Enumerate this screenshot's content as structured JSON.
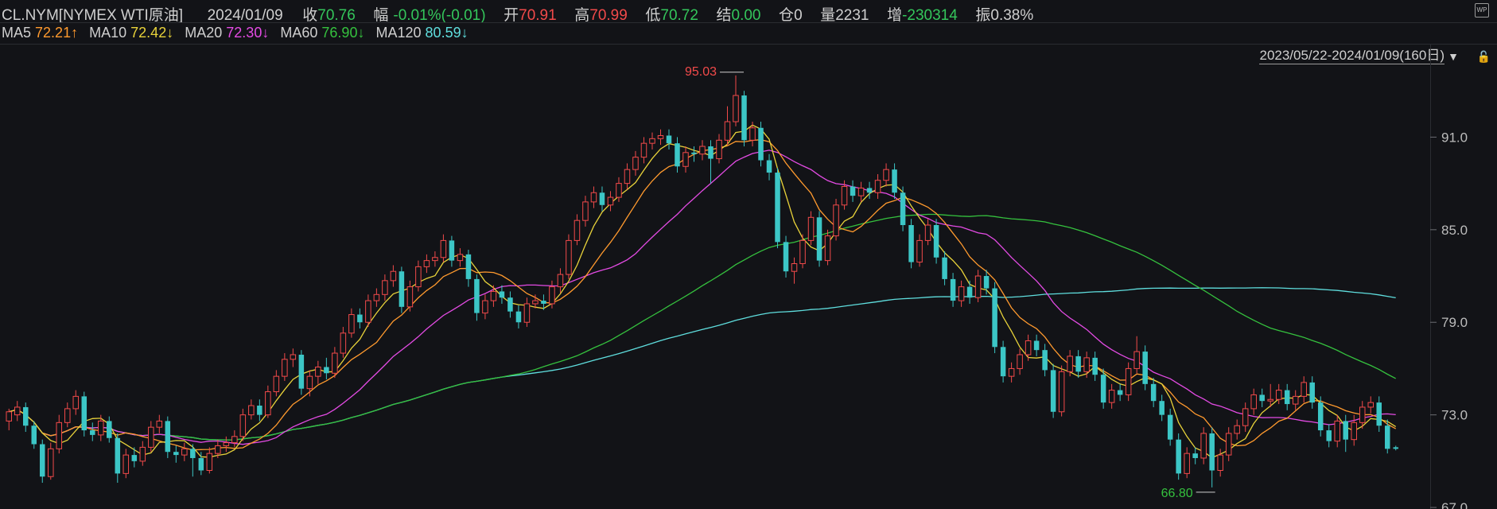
{
  "header": {
    "symbol": "CL.NYM[NYMEX WTI原油]",
    "date": "2024/01/09",
    "close_label": "收",
    "close_value": "70.76",
    "change_label": "幅",
    "change_value": "-0.01%(-0.01)",
    "open_label": "开",
    "open_value": "70.91",
    "high_label": "高",
    "high_value": "70.99",
    "low_label": "低",
    "low_value": "70.72",
    "settle_label": "结",
    "settle_value": "0.00",
    "oi_label": "仓",
    "oi_value": "0",
    "volume_label": "量",
    "volume_value": "2231",
    "increase_label": "增",
    "increase_value": "-230314",
    "amplitude_label": "振",
    "amplitude_value": "0.38%"
  },
  "ma_bar": {
    "ma5_label": "MA5",
    "ma5_value": "72.21↑",
    "ma10_label": "MA10",
    "ma10_value": "72.42↓",
    "ma20_label": "MA20",
    "ma20_value": "72.30↓",
    "ma60_label": "MA60",
    "ma60_value": "76.90↓",
    "ma120_label": "MA120",
    "ma120_value": "80.59↓"
  },
  "range_label": "2023/05/22-2024/01/09(160日)",
  "dropdown_icon": "triangle-down-icon",
  "wp_badge": "WP",
  "lock_icon": "lock-icon",
  "colors": {
    "up": "#f24a4a",
    "down": "#3cc6c6",
    "ma5": "#e8d23a",
    "ma10": "#ff9a2e",
    "ma20": "#e44be4",
    "ma60": "#35c13e",
    "ma120": "#5fdede",
    "bg": "#121317"
  },
  "chart_data": {
    "type": "candlestick",
    "y_ticks": [
      "91.0",
      "85.0",
      "79.0",
      "73.0",
      "67.0"
    ],
    "y_tick_values": [
      91,
      85,
      79,
      73,
      67
    ],
    "ylim": [
      66.9,
      97.0
    ],
    "max_annotation": "95.03",
    "min_annotation": "66.80",
    "candles": [
      [
        72.6,
        73.2,
        72.0,
        73.4
      ],
      [
        73.0,
        73.5,
        72.6,
        73.9
      ],
      [
        73.5,
        72.3,
        71.9,
        73.8
      ],
      [
        72.3,
        71.1,
        70.8,
        72.6
      ],
      [
        71.1,
        69.0,
        68.6,
        71.4
      ],
      [
        69.0,
        70.8,
        68.8,
        71.2
      ],
      [
        70.8,
        72.5,
        70.5,
        73.0
      ],
      [
        72.5,
        73.4,
        72.2,
        73.8
      ],
      [
        73.4,
        74.2,
        73.0,
        74.6
      ],
      [
        74.2,
        72.0,
        71.6,
        74.5
      ],
      [
        72.0,
        71.7,
        71.3,
        72.5
      ],
      [
        71.7,
        72.6,
        71.3,
        73.0
      ],
      [
        72.6,
        71.5,
        71.2,
        72.9
      ],
      [
        71.5,
        69.2,
        68.6,
        71.8
      ],
      [
        69.2,
        70.4,
        68.9,
        70.8
      ],
      [
        70.4,
        70.0,
        69.6,
        70.9
      ],
      [
        70.0,
        70.9,
        69.7,
        71.3
      ],
      [
        70.9,
        72.2,
        70.6,
        72.6
      ],
      [
        72.2,
        72.6,
        71.8,
        73.0
      ],
      [
        72.6,
        70.6,
        70.2,
        72.9
      ],
      [
        70.6,
        70.4,
        69.9,
        71.0
      ],
      [
        70.4,
        70.8,
        70.0,
        71.2
      ],
      [
        70.8,
        70.2,
        69.0,
        71.1
      ],
      [
        70.2,
        69.4,
        69.1,
        70.6
      ],
      [
        69.4,
        70.5,
        69.2,
        70.9
      ],
      [
        70.5,
        71.0,
        70.2,
        71.4
      ],
      [
        71.0,
        71.2,
        70.6,
        71.6
      ],
      [
        71.2,
        71.6,
        70.9,
        72.0
      ],
      [
        71.6,
        73.0,
        71.3,
        73.4
      ],
      [
        73.0,
        73.6,
        72.7,
        74.0
      ],
      [
        73.6,
        73.0,
        72.6,
        74.0
      ],
      [
        73.0,
        74.5,
        72.8,
        74.9
      ],
      [
        74.5,
        75.5,
        74.2,
        75.9
      ],
      [
        75.5,
        76.6,
        75.2,
        77.0
      ],
      [
        76.6,
        76.9,
        76.1,
        77.3
      ],
      [
        76.9,
        74.7,
        74.3,
        77.2
      ],
      [
        74.7,
        75.5,
        74.2,
        75.9
      ],
      [
        75.5,
        76.1,
        75.0,
        76.5
      ],
      [
        76.1,
        75.7,
        75.3,
        76.7
      ],
      [
        75.7,
        77.0,
        75.4,
        77.4
      ],
      [
        77.0,
        78.3,
        76.7,
        78.7
      ],
      [
        78.3,
        79.5,
        78.0,
        79.9
      ],
      [
        79.5,
        79.0,
        78.6,
        79.9
      ],
      [
        79.0,
        80.4,
        78.7,
        80.8
      ],
      [
        80.4,
        80.8,
        80.0,
        81.2
      ],
      [
        80.8,
        81.7,
        80.4,
        82.1
      ],
      [
        81.7,
        82.3,
        81.3,
        82.7
      ],
      [
        82.3,
        80.0,
        79.6,
        82.6
      ],
      [
        80.0,
        81.3,
        79.7,
        81.7
      ],
      [
        81.3,
        82.6,
        81.0,
        83.0
      ],
      [
        82.6,
        83.0,
        82.2,
        83.4
      ],
      [
        83.0,
        83.2,
        82.6,
        83.6
      ],
      [
        83.2,
        84.3,
        82.9,
        84.7
      ],
      [
        84.3,
        83.0,
        82.6,
        84.6
      ],
      [
        83.0,
        83.4,
        82.6,
        83.8
      ],
      [
        83.4,
        81.8,
        81.3,
        83.7
      ],
      [
        81.8,
        79.6,
        79.1,
        82.1
      ],
      [
        79.6,
        80.4,
        79.2,
        80.8
      ],
      [
        80.4,
        81.0,
        80.0,
        81.4
      ],
      [
        81.0,
        80.6,
        80.2,
        81.4
      ],
      [
        80.6,
        79.7,
        79.3,
        81.0
      ],
      [
        79.7,
        79.0,
        78.6,
        80.1
      ],
      [
        79.0,
        80.2,
        78.7,
        80.6
      ],
      [
        80.2,
        80.4,
        79.9,
        80.8
      ],
      [
        80.4,
        80.2,
        79.8,
        80.8
      ],
      [
        80.2,
        81.3,
        79.9,
        81.7
      ],
      [
        81.3,
        82.1,
        80.9,
        82.5
      ],
      [
        82.1,
        84.3,
        81.8,
        84.7
      ],
      [
        84.3,
        85.6,
        84.0,
        86.0
      ],
      [
        85.6,
        86.8,
        85.2,
        87.2
      ],
      [
        86.8,
        87.4,
        86.4,
        87.8
      ],
      [
        87.4,
        86.6,
        86.2,
        87.8
      ],
      [
        86.6,
        87.1,
        86.2,
        87.5
      ],
      [
        87.1,
        88.0,
        86.8,
        88.4
      ],
      [
        88.0,
        88.9,
        87.6,
        89.3
      ],
      [
        88.9,
        89.7,
        88.5,
        90.1
      ],
      [
        89.7,
        90.6,
        89.3,
        91.0
      ],
      [
        90.6,
        90.9,
        90.2,
        91.3
      ],
      [
        90.9,
        91.1,
        90.5,
        91.5
      ],
      [
        91.1,
        90.6,
        90.2,
        91.5
      ],
      [
        90.6,
        89.1,
        88.7,
        91.0
      ],
      [
        89.1,
        90.0,
        88.7,
        90.4
      ],
      [
        90.0,
        89.9,
        89.4,
        90.4
      ],
      [
        89.9,
        90.4,
        89.5,
        90.8
      ],
      [
        90.4,
        89.6,
        88.0,
        90.8
      ],
      [
        89.6,
        90.8,
        89.3,
        91.2
      ],
      [
        90.8,
        92.0,
        90.5,
        93.0
      ],
      [
        92.0,
        93.7,
        91.7,
        95.0
      ],
      [
        93.7,
        90.8,
        90.4,
        94.0
      ],
      [
        90.8,
        91.6,
        90.4,
        92.0
      ],
      [
        91.6,
        89.5,
        89.1,
        92.0
      ],
      [
        89.5,
        88.7,
        88.2,
        89.9
      ],
      [
        88.7,
        84.2,
        83.8,
        89.0
      ],
      [
        84.2,
        82.3,
        81.9,
        84.6
      ],
      [
        82.3,
        82.8,
        81.5,
        83.2
      ],
      [
        82.8,
        84.3,
        82.5,
        84.7
      ],
      [
        84.3,
        85.8,
        84.0,
        86.2
      ],
      [
        85.8,
        83.0,
        82.6,
        86.2
      ],
      [
        83.0,
        84.6,
        82.7,
        85.0
      ],
      [
        84.6,
        86.6,
        84.3,
        87.0
      ],
      [
        86.6,
        87.8,
        86.3,
        88.2
      ],
      [
        87.8,
        87.2,
        86.8,
        88.2
      ],
      [
        87.2,
        87.7,
        86.8,
        88.1
      ],
      [
        87.7,
        87.4,
        87.0,
        88.1
      ],
      [
        87.4,
        88.2,
        87.0,
        88.6
      ],
      [
        88.2,
        88.9,
        87.8,
        89.3
      ],
      [
        88.9,
        87.4,
        87.0,
        89.3
      ],
      [
        87.4,
        85.3,
        84.9,
        87.8
      ],
      [
        85.3,
        82.9,
        82.5,
        85.7
      ],
      [
        82.9,
        84.3,
        82.6,
        84.7
      ],
      [
        84.3,
        85.3,
        84.0,
        85.7
      ],
      [
        85.3,
        83.2,
        82.8,
        85.7
      ],
      [
        83.2,
        81.8,
        81.4,
        83.6
      ],
      [
        81.8,
        80.4,
        80.0,
        82.2
      ],
      [
        80.4,
        81.3,
        80.0,
        81.7
      ],
      [
        81.3,
        80.6,
        80.2,
        81.7
      ],
      [
        80.6,
        82.0,
        80.3,
        82.4
      ],
      [
        82.0,
        81.2,
        80.8,
        82.4
      ],
      [
        81.2,
        77.4,
        77.0,
        81.6
      ],
      [
        77.4,
        75.5,
        75.1,
        77.8
      ],
      [
        75.5,
        76.0,
        75.1,
        76.4
      ],
      [
        76.0,
        76.9,
        75.6,
        77.3
      ],
      [
        76.9,
        77.8,
        76.5,
        78.2
      ],
      [
        77.8,
        77.2,
        76.8,
        78.2
      ],
      [
        77.2,
        75.9,
        75.5,
        77.6
      ],
      [
        75.9,
        73.2,
        72.8,
        76.3
      ],
      [
        73.2,
        75.8,
        72.9,
        76.2
      ],
      [
        75.8,
        76.8,
        75.5,
        77.2
      ],
      [
        76.8,
        75.8,
        75.4,
        77.2
      ],
      [
        75.8,
        76.7,
        75.4,
        77.1
      ],
      [
        76.7,
        75.6,
        75.2,
        77.1
      ],
      [
        75.6,
        73.8,
        73.4,
        76.0
      ],
      [
        73.8,
        74.6,
        73.4,
        75.0
      ],
      [
        74.6,
        74.3,
        73.9,
        75.0
      ],
      [
        74.3,
        76.0,
        73.9,
        76.4
      ],
      [
        76.0,
        77.1,
        75.7,
        78.1
      ],
      [
        77.1,
        75.0,
        74.6,
        77.5
      ],
      [
        75.0,
        73.9,
        73.5,
        75.4
      ],
      [
        73.9,
        73.0,
        72.6,
        74.3
      ],
      [
        73.0,
        71.4,
        71.0,
        73.4
      ],
      [
        71.4,
        69.2,
        68.8,
        71.8
      ],
      [
        69.2,
        70.5,
        68.9,
        70.9
      ],
      [
        70.5,
        70.2,
        69.8,
        70.9
      ],
      [
        70.2,
        71.8,
        69.8,
        72.2
      ],
      [
        71.8,
        69.4,
        68.3,
        72.2
      ],
      [
        69.4,
        70.4,
        69.0,
        70.8
      ],
      [
        70.4,
        71.8,
        70.0,
        72.2
      ],
      [
        71.8,
        72.3,
        71.4,
        72.7
      ],
      [
        72.3,
        73.4,
        71.9,
        73.8
      ],
      [
        73.4,
        74.3,
        73.0,
        74.7
      ],
      [
        74.3,
        73.9,
        73.5,
        74.7
      ],
      [
        73.9,
        74.0,
        73.5,
        75.0
      ],
      [
        74.0,
        74.6,
        73.7,
        75.0
      ],
      [
        74.6,
        73.7,
        73.3,
        75.0
      ],
      [
        73.7,
        74.2,
        73.3,
        74.6
      ],
      [
        74.2,
        75.1,
        73.8,
        75.5
      ],
      [
        75.1,
        73.8,
        73.4,
        75.5
      ],
      [
        73.8,
        72.0,
        71.6,
        74.2
      ],
      [
        72.0,
        71.3,
        70.9,
        72.4
      ],
      [
        71.3,
        72.6,
        70.9,
        73.0
      ],
      [
        72.6,
        71.4,
        70.6,
        73.0
      ],
      [
        71.4,
        72.5,
        71.0,
        73.0
      ],
      [
        72.5,
        73.5,
        72.1,
        73.9
      ],
      [
        73.5,
        73.8,
        73.1,
        74.2
      ],
      [
        73.8,
        72.3,
        71.9,
        74.2
      ],
      [
        72.3,
        70.8,
        70.5,
        72.7
      ],
      [
        70.9,
        70.8,
        70.7,
        71.0
      ]
    ]
  }
}
